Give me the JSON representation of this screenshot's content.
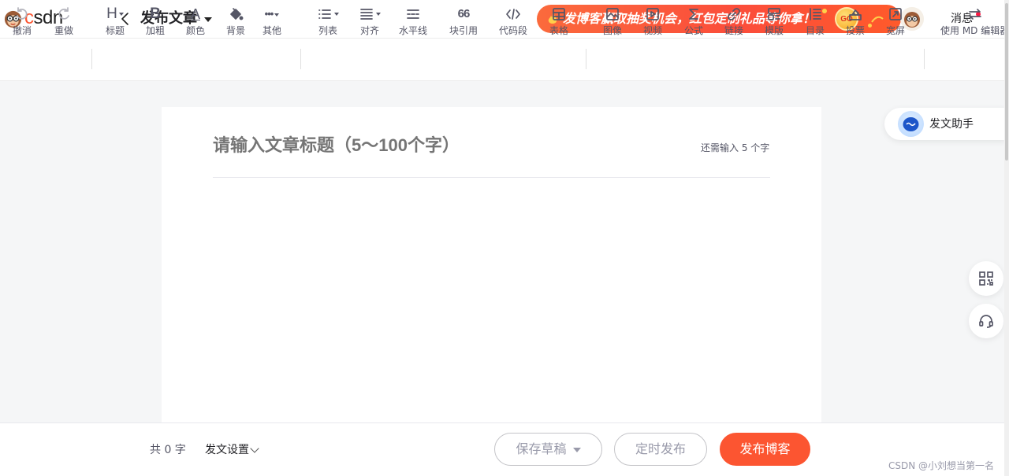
{
  "header": {
    "logo_text": "CSDN",
    "page_title": "发布文章",
    "banner_text": "发博客赢取抽奖机会，红包定制礼品等你拿！",
    "banner_go": "GO",
    "messages_label": "消息"
  },
  "toolbar": {
    "undo": "撤消",
    "redo": "重做",
    "heading": "标题",
    "bold": "加粗",
    "color": "颜色",
    "background": "背景",
    "other": "其他",
    "list": "列表",
    "align": "对齐",
    "hr": "水平线",
    "quote": "块引用",
    "code": "代码段",
    "table": "表格",
    "image": "图像",
    "video": "视频",
    "formula": "公式",
    "link": "链接",
    "template": "模版",
    "toc": "目录",
    "vote": "投票",
    "widescreen": "宽屏",
    "md_editor": "使用 MD 编辑器",
    "heading_glyph": "H",
    "bold_glyph": "B",
    "color_glyph": "A",
    "other_glyph": "•••",
    "quote_glyph": "66"
  },
  "editor": {
    "title_placeholder": "请输入文章标题（5～100个字）",
    "title_value": "",
    "remaining_hint": "还需输入 5 个字"
  },
  "sidebar": {
    "assistant_label": "发文助手"
  },
  "footer": {
    "word_count": "共 0 字",
    "settings_label": "发文设置",
    "save_draft": "保存草稿",
    "scheduled": "定时发布",
    "publish": "发布博客"
  },
  "watermark": "CSDN @小刘想当第一名",
  "colors": {
    "brand": "#fc5531",
    "notify_dot": "#fc1944",
    "placeholder": "#c1c1cc"
  }
}
